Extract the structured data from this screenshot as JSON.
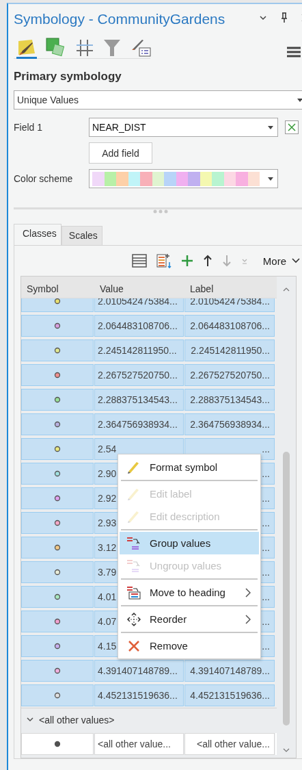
{
  "window": {
    "title": "Symbology - CommunityGardens"
  },
  "tabs": [
    {
      "kind": "primary",
      "selected": true
    },
    {
      "kind": "vary",
      "selected": false
    },
    {
      "kind": "grid",
      "selected": false
    },
    {
      "kind": "filter",
      "selected": false
    },
    {
      "kind": "label",
      "selected": false
    }
  ],
  "section_title": "Primary symbology",
  "renderer": {
    "value": "Unique Values"
  },
  "field_1": {
    "label": "Field 1",
    "value": "NEAR_DIST"
  },
  "add_field_button": "Add field",
  "color_scheme": {
    "label": "Color scheme",
    "colors": [
      {
        "color": "#f0d8f8"
      },
      {
        "color": "#b8f0a8"
      },
      {
        "color": "#fdd0a8"
      },
      {
        "color": "#c0f4f8"
      },
      {
        "color": "#f8b0b8"
      },
      {
        "color": "#e0f4d0"
      },
      {
        "color": "#b8d4f8"
      },
      {
        "color": "#f0b0f0"
      },
      {
        "color": "#c0b0f0"
      },
      {
        "color": "#f4f8b0"
      },
      {
        "color": "#b8f4d0"
      },
      {
        "color": "#fcd8e4"
      },
      {
        "color": "#f8b0e0"
      },
      {
        "color": "#fce0d4"
      }
    ]
  },
  "sub_tabs": [
    {
      "label": "Classes",
      "selected": true
    },
    {
      "label": "Scales",
      "selected": false
    }
  ],
  "more_button": "More",
  "table": {
    "columns": [
      "Symbol",
      "Value",
      "Label"
    ],
    "rows": [
      {
        "color": "#e8e070",
        "value": "2.010542475384...",
        "label": "2.010542475384...",
        "selected": true
      },
      {
        "color": "#d8a0e0",
        "value": "2.064483108706...",
        "label": "2.064483108706...",
        "selected": true
      },
      {
        "color": "#e0e890",
        "value": "2.245142811950...",
        "label": "2.245142811950...",
        "selected": true
      },
      {
        "color": "#f09090",
        "value": "2.267527520750...",
        "label": "2.267527520750...",
        "selected": true
      },
      {
        "color": "#98e098",
        "value": "2.288375134543...",
        "label": "2.288375134543...",
        "selected": true
      },
      {
        "color": "#b8b0e0",
        "value": "2.364756938934...",
        "label": "2.364756938934...",
        "selected": true
      },
      {
        "color": "#e8e880",
        "value": "2.54",
        "label": "...",
        "selected": true
      },
      {
        "color": "#a0e0e0",
        "value": "2.90",
        "label": "...",
        "selected": true
      },
      {
        "color": "#e0a0f0",
        "value": "2.92",
        "label": "...",
        "selected": true
      },
      {
        "color": "#f4a8c8",
        "value": "2.93",
        "label": "...",
        "selected": true
      },
      {
        "color": "#f0c888",
        "value": "3.12",
        "label": "...",
        "selected": true
      },
      {
        "color": "#e8ecd8",
        "value": "3.79",
        "label": "...",
        "selected": true
      },
      {
        "color": "#a8e8c0",
        "value": "4.01",
        "label": "...",
        "selected": true
      },
      {
        "color": "#f0a0d0",
        "value": "4.07",
        "label": "...",
        "selected": true
      },
      {
        "color": "#c8b0f0",
        "value": "4.15",
        "label": "...",
        "selected": true
      },
      {
        "color": "#f0b0e0",
        "value": "4.391407148789...",
        "label": "4.391407148789...",
        "selected": true
      },
      {
        "color": "#e0e0e0",
        "value": "4.452131519636...",
        "label": "4.452131519636...",
        "selected": true
      }
    ],
    "group": {
      "heading": "<all other values>",
      "expanded": true,
      "row": {
        "color": "#505050",
        "value": "<all other value...",
        "label": "<all other value...",
        "selected": false
      }
    }
  },
  "context_menu": [
    {
      "kind": "pencil",
      "label": "Format symbol",
      "disabled": false,
      "selected": false,
      "submenu": false
    },
    {
      "kind": "separator"
    },
    {
      "kind": "pencil",
      "label": "Edit label",
      "disabled": true,
      "selected": false,
      "submenu": false
    },
    {
      "kind": "pencil",
      "label": "Edit description",
      "disabled": true,
      "selected": false,
      "submenu": false
    },
    {
      "kind": "separator"
    },
    {
      "kind": "group",
      "label": "Group values",
      "disabled": false,
      "selected": true,
      "submenu": false
    },
    {
      "kind": "group",
      "label": "Ungroup values",
      "disabled": true,
      "selected": false,
      "submenu": false
    },
    {
      "kind": "separator"
    },
    {
      "kind": "heading",
      "label": "Move to heading",
      "disabled": false,
      "selected": false,
      "submenu": true
    },
    {
      "kind": "separator"
    },
    {
      "kind": "move",
      "label": "Reorder",
      "disabled": false,
      "selected": false,
      "submenu": true
    },
    {
      "kind": "separator"
    },
    {
      "kind": "remove",
      "label": "Remove",
      "disabled": false,
      "selected": false,
      "submenu": false
    }
  ]
}
